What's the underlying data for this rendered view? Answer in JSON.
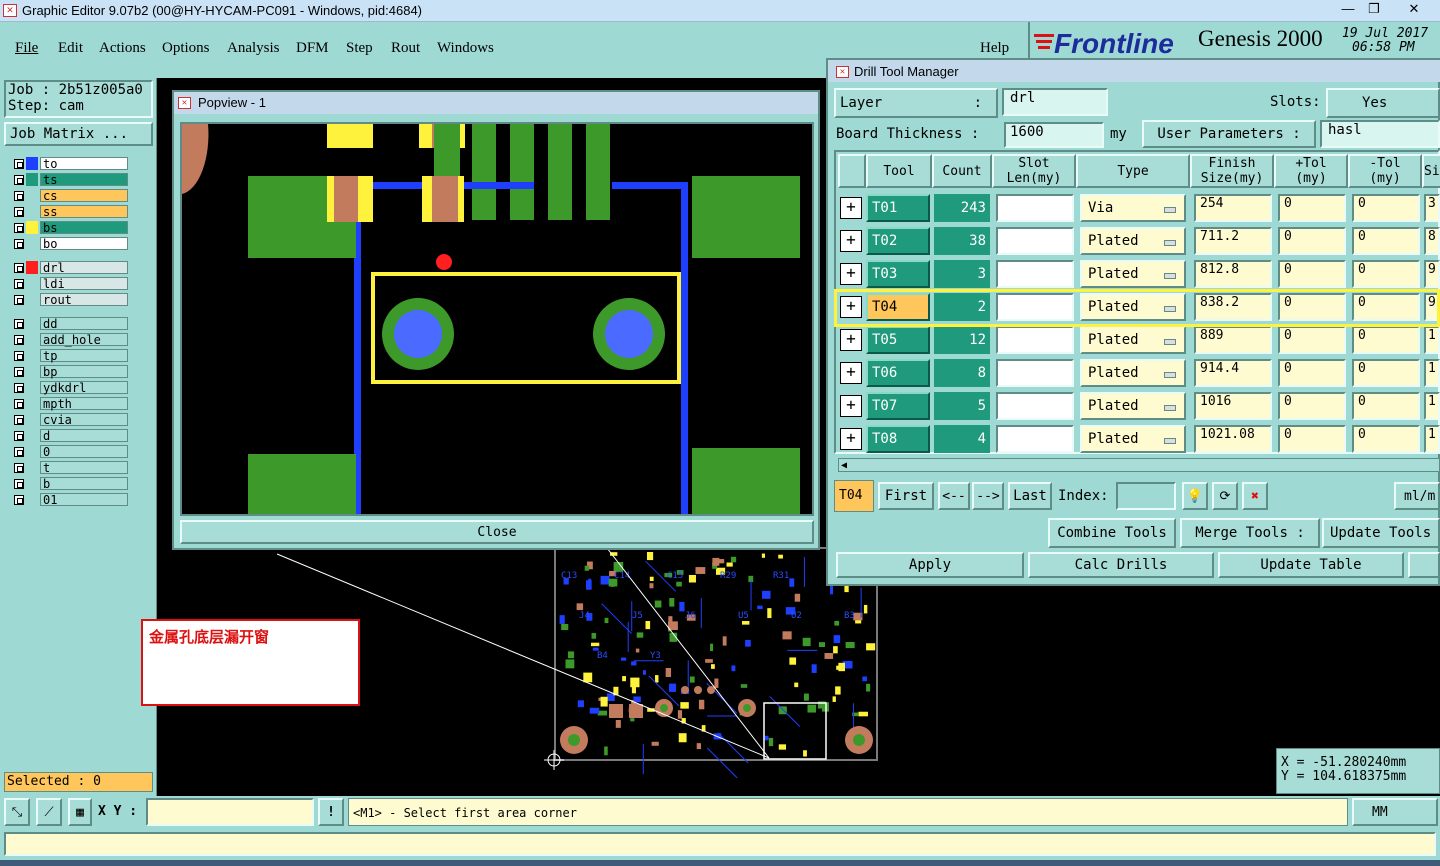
{
  "window": {
    "title": "Graphic Editor 9.07b2 (00@HY-HYCAM-PC091 - Windows, pid:4684)"
  },
  "menu": {
    "items": [
      "File",
      "Edit",
      "Actions",
      "Options",
      "Analysis",
      "DFM",
      "Step",
      "Rout",
      "Windows"
    ],
    "help": "Help"
  },
  "brand": {
    "logo": "Frontline",
    "product": "Genesis 2000",
    "date": "19 Jul 2017",
    "time": "06:58 PM"
  },
  "job": {
    "job_label": "Job : 2b51z005a0",
    "step_label": "Step: cam",
    "matrix_button": "Job Matrix ..."
  },
  "layers_group1": [
    {
      "name": "to",
      "color": "#1f3fff",
      "bg": "#ffffff"
    },
    {
      "name": "ts",
      "color": "#1f9a7c",
      "bg": "#1f9a7c"
    },
    {
      "name": "cs",
      "color": "",
      "bg": "#ffc65c"
    },
    {
      "name": "ss",
      "color": "",
      "bg": "#ffc65c"
    },
    {
      "name": "bs",
      "color": "#fff23c",
      "bg": "#1f9a7c"
    },
    {
      "name": "bo",
      "color": "",
      "bg": "#ffffff"
    }
  ],
  "layers_group2": [
    {
      "name": "drl",
      "color": "#ff1f1f",
      "bg": "#d9e6e6"
    },
    {
      "name": "ldi",
      "color": "",
      "bg": "#d9e6e6"
    },
    {
      "name": "rout",
      "color": "",
      "bg": "#d9e6e6"
    }
  ],
  "layers_group3": [
    "dd",
    "add_hole",
    "tp",
    "bp",
    "ydkdrl",
    "mpth",
    "cvia",
    "d",
    "0",
    "t",
    "b",
    "01"
  ],
  "selected": "Selected : 0",
  "popview": {
    "title": "Popview - 1",
    "close": "Close"
  },
  "annotation": {
    "text": "金属孔底层漏开窗"
  },
  "drill_manager": {
    "title": "Drill Tool Manager",
    "layer_label": "Layer",
    "layer_colon": ":",
    "layer_value": "drl",
    "slots_label": "Slots:",
    "slots_value": "Yes",
    "thickness_label": "Board Thickness :",
    "thickness_value": "1600",
    "thickness_unit": "my",
    "user_params_label": "User Parameters :",
    "user_params_value": "hasl",
    "headers": {
      "tool": "Tool",
      "count": "Count",
      "slot": "Slot\nLen(my)",
      "type": "Type",
      "finish": "Finish\nSize(my)",
      "ptol": "+Tol\n(my)",
      "ntol": "-Tol\n(my)",
      "s": "Si"
    },
    "rows": [
      {
        "tool": "T01",
        "count": "243",
        "type": "Via",
        "finish": "254",
        "ptol": "0",
        "ntol": "0",
        "s": "3"
      },
      {
        "tool": "T02",
        "count": "38",
        "type": "Plated",
        "finish": "711.2",
        "ptol": "0",
        "ntol": "0",
        "s": "8"
      },
      {
        "tool": "T03",
        "count": "3",
        "type": "Plated",
        "finish": "812.8",
        "ptol": "0",
        "ntol": "0",
        "s": "9"
      },
      {
        "tool": "T04",
        "count": "2",
        "type": "Plated",
        "finish": "838.2",
        "ptol": "0",
        "ntol": "0",
        "s": "9"
      },
      {
        "tool": "T05",
        "count": "12",
        "type": "Plated",
        "finish": "889",
        "ptol": "0",
        "ntol": "0",
        "s": "1"
      },
      {
        "tool": "T06",
        "count": "8",
        "type": "Plated",
        "finish": "914.4",
        "ptol": "0",
        "ntol": "0",
        "s": "1"
      },
      {
        "tool": "T07",
        "count": "5",
        "type": "Plated",
        "finish": "1016",
        "ptol": "0",
        "ntol": "0",
        "s": "1"
      },
      {
        "tool": "T08",
        "count": "4",
        "type": "Plated",
        "finish": "1021.08",
        "ptol": "0",
        "ntol": "0",
        "s": "1"
      }
    ],
    "current_tool": "T04",
    "nav": {
      "first": "First",
      "prev": "<--",
      "next": "-->",
      "last": "Last",
      "index_label": "Index:",
      "units": "ml/m"
    },
    "buttons": {
      "combine": "Combine Tools",
      "merge": "Merge Tools :",
      "update_tools": "Update Tools",
      "apply": "Apply",
      "calc": "Calc Drills",
      "update_table": "Update Table"
    }
  },
  "coords": {
    "x": "X = -51.280240mm",
    "y": "Y = 104.618375mm"
  },
  "bottom": {
    "xy_label": "X Y :",
    "message": "<M1> - Select first area corner",
    "units": "MM"
  },
  "pcb_labels": [
    "C13",
    "C14",
    "C15",
    "R29",
    "R31",
    "R30",
    "J4",
    "J5",
    "J6",
    "U5",
    "U2",
    "B3",
    "B4",
    "Y3"
  ]
}
